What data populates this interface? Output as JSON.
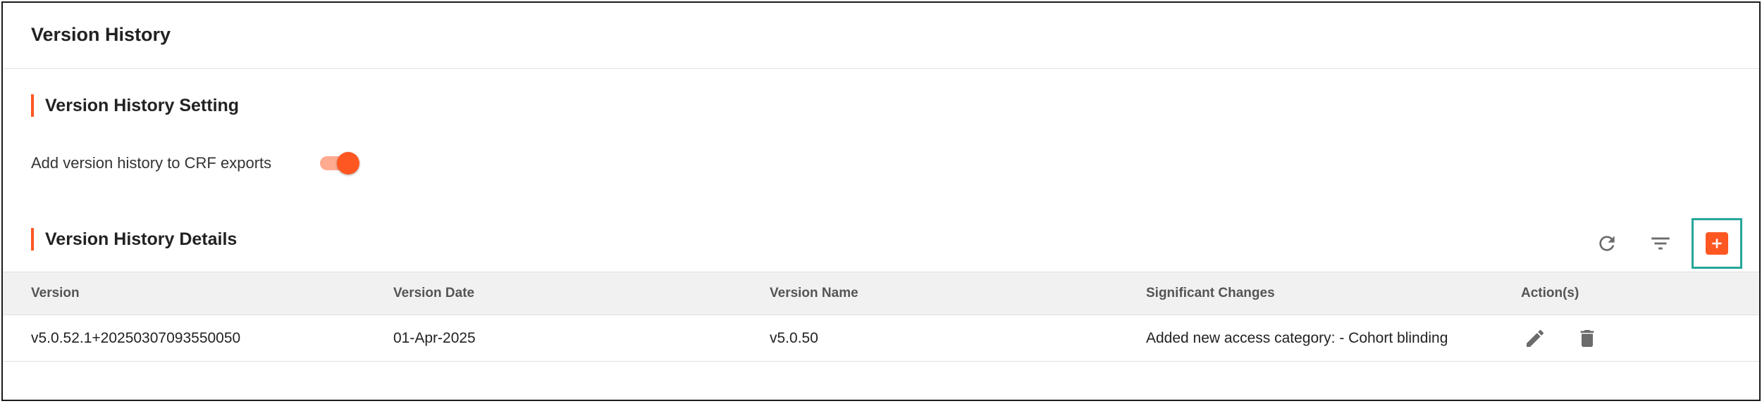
{
  "header": {
    "title": "Version History"
  },
  "settings_section": {
    "title": "Version History Setting",
    "export_toggle": {
      "label": "Add version history to CRF exports",
      "enabled": true
    }
  },
  "details_section": {
    "title": "Version History Details",
    "toolbar": {
      "refresh_icon": "refresh-icon",
      "filter_icon": "filter-icon",
      "add_icon": "plus-icon"
    }
  },
  "table": {
    "columns": [
      "Version",
      "Version Date",
      "Version Name",
      "Significant Changes",
      "Action(s)"
    ],
    "rows": [
      {
        "version": "v5.0.52.1+20250307093550050",
        "version_date": "01-Apr-2025",
        "version_name": "v5.0.50",
        "significant_changes": "Added new access category: - Cohort blinding",
        "actions": [
          "edit-icon",
          "delete-icon"
        ]
      }
    ]
  },
  "colors": {
    "accent": "#ff5722",
    "toggle_track": "#ffab91",
    "highlight_border": "#26a69a",
    "header_bg": "#f1f1f1",
    "icon_gray": "#6b6b6b"
  }
}
